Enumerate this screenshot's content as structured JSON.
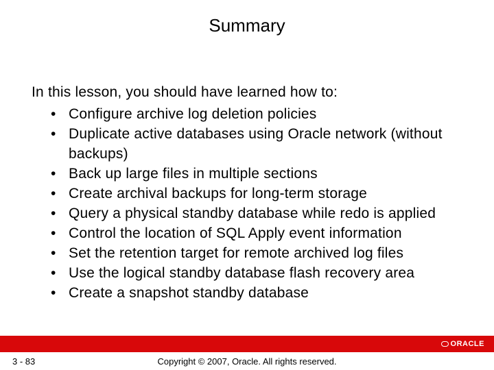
{
  "title": "Summary",
  "intro": "In this lesson, you should have learned how to:",
  "bullets": [
    "Configure archive log deletion policies",
    "Duplicate active databases using Oracle network (without backups)",
    "Back up large files in multiple sections",
    "Create archival backups for long-term storage",
    "Query a physical standby database while redo is applied",
    "Control the location of SQL Apply event information",
    "Set the retention target for remote archived log files",
    "Use the logical standby database flash recovery area",
    "Create a snapshot standby database"
  ],
  "footer": {
    "page": "3 - 83",
    "copyright": "Copyright © 2007, Oracle. All rights reserved.",
    "logo_text": "ORACLE"
  },
  "colors": {
    "brand_red": "#d8080a"
  }
}
